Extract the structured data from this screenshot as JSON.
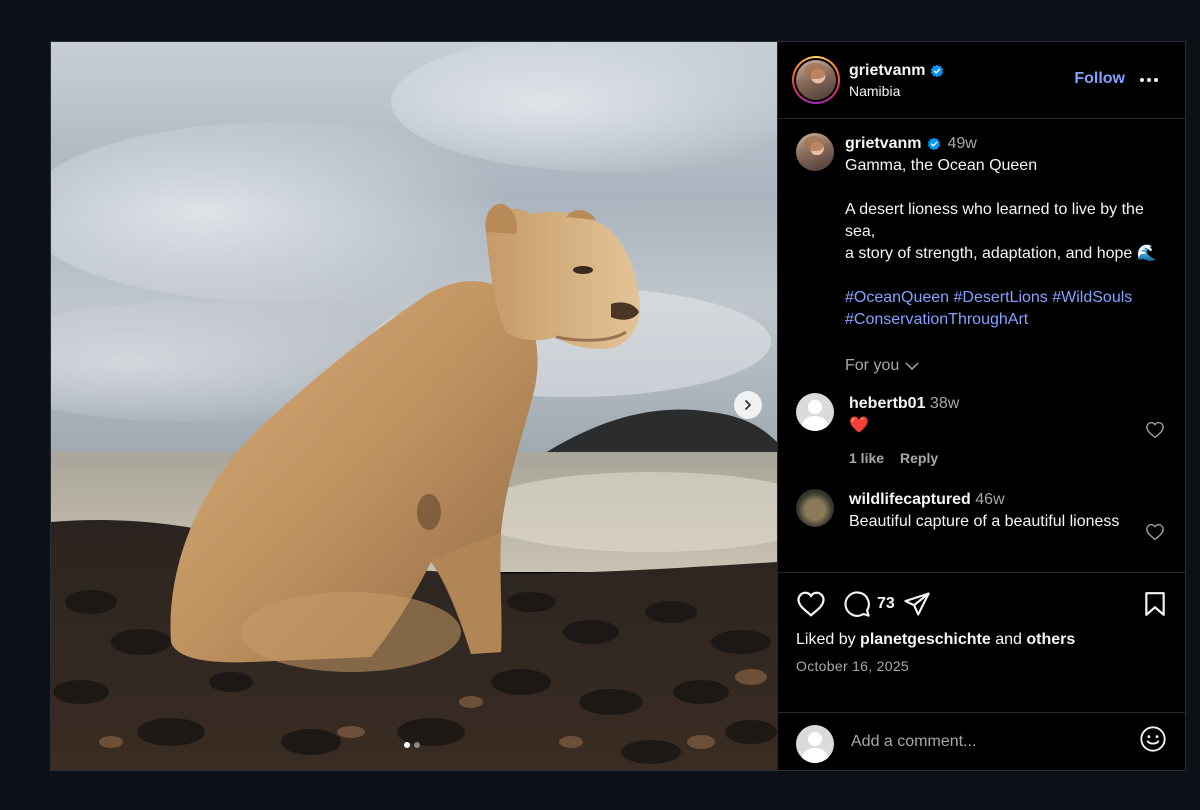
{
  "post": {
    "media": {
      "alt": "Lioness sitting on dark pebble beach with ocean waves",
      "slide_count": 2,
      "active_slide": 1
    },
    "header": {
      "username": "grietvanm",
      "location": "Namibia",
      "follow_label": "Follow"
    },
    "caption": {
      "username": "grietvanm",
      "time": "49w",
      "lines": [
        "Gamma, the Ocean Queen",
        "",
        "A desert lioness who learned to live by the sea,",
        "a story of strength, adaptation, and hope 🌊",
        ""
      ],
      "hashtags": "#OceanQueen #DesertLions #WildSouls #ConservationThroughArt",
      "for_you": "For you"
    },
    "comments": [
      {
        "username": "hebertb01",
        "time": "38w",
        "text": "❤️",
        "likes": "1 like",
        "reply": "Reply"
      },
      {
        "username": "wildlifecaptured",
        "time": "46w",
        "text": "Beautiful capture of a beautiful lioness"
      }
    ],
    "actions": {
      "comment_count": "73",
      "liked_by_prefix": "Liked by",
      "liked_by_user": "planetgeschichte",
      "liked_by_and": "and",
      "liked_by_others": "others",
      "date": "October 16, 2025"
    },
    "add_comment": {
      "placeholder": "Add a comment..."
    },
    "colors": {
      "link": "#85a1ff",
      "verified": "#0095f6",
      "background": "#000000",
      "page": "#0b1117"
    }
  }
}
